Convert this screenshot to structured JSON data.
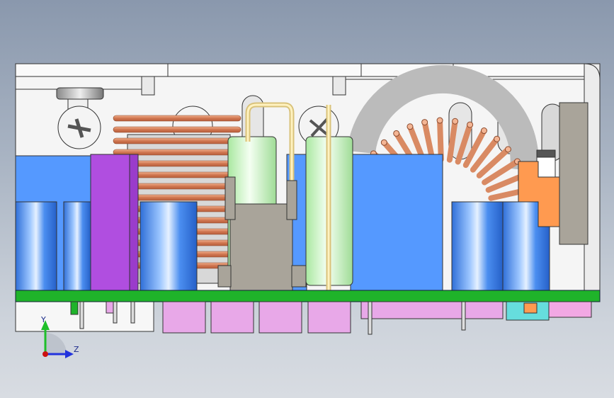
{
  "viewport": {
    "background_top": "#8a98ad",
    "background_bottom": "#d8dce2"
  },
  "triad": {
    "x_label": "Y",
    "z_label": "Z",
    "y_color": "#1fbf2a",
    "z_color": "#2233dd",
    "origin_color": "#cc1111"
  },
  "colors": {
    "housing": "#f4f4f4",
    "pcb": "#1fb32a",
    "blue_block": "#5599ff",
    "capacitor_blue": "#3d86ee",
    "purple_part": "#b04ee0",
    "copper": "#e0926a",
    "green_cap": "#c9f5c0",
    "grey_part": "#a9a49a",
    "pink_pin": "#e8a8e8",
    "orange_part": "#ff9a50",
    "cyan_part": "#66dddd"
  },
  "components": [
    {
      "name": "housing",
      "label": ""
    },
    {
      "name": "pcb",
      "label": ""
    },
    {
      "name": "transformer-coil",
      "label": ""
    },
    {
      "name": "toroid-inductor",
      "label": ""
    },
    {
      "name": "electrolytic-capacitor",
      "label": ""
    }
  ]
}
